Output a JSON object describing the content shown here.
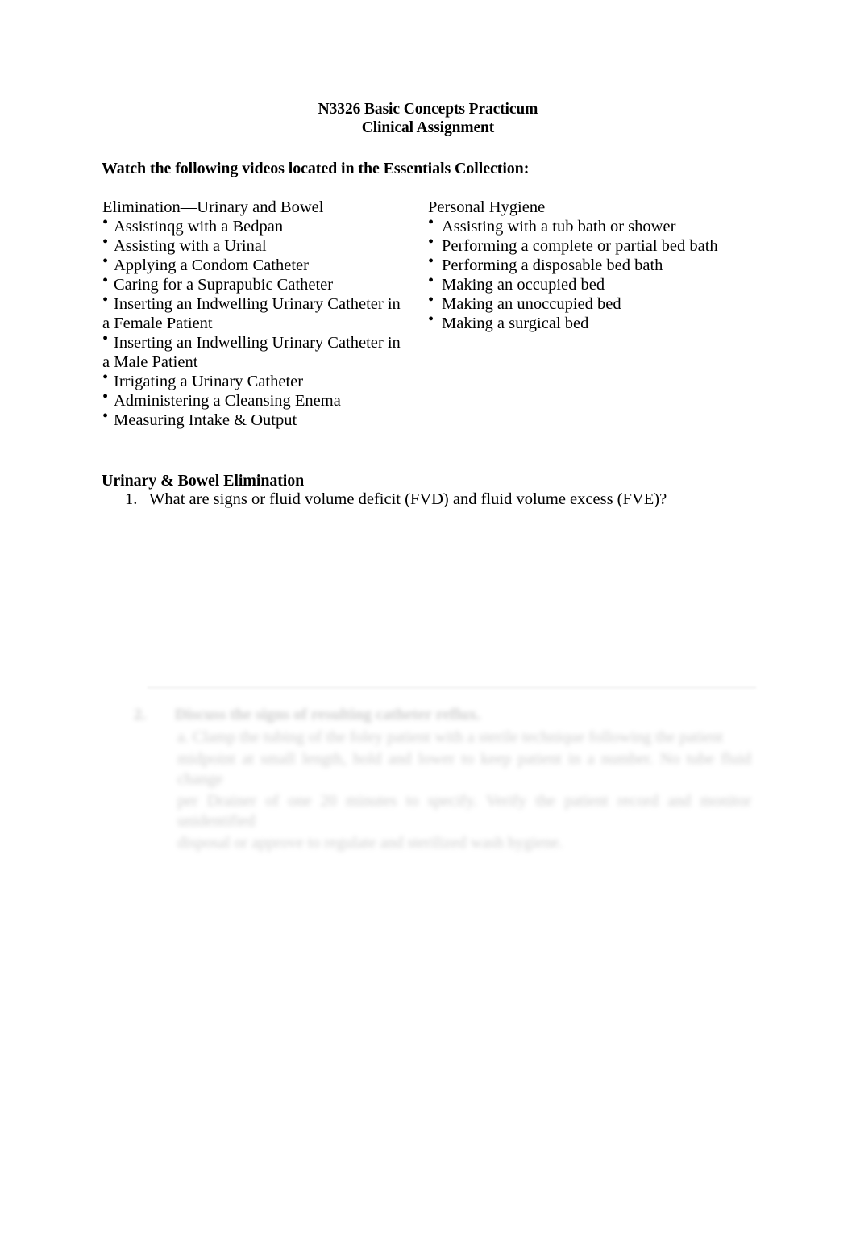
{
  "document": {
    "title_line1": "N3326 Basic Concepts Practicum",
    "title_line2": "Clinical Assignment",
    "watch_heading": "Watch the following videos located in the Essentials Collection:"
  },
  "columns": {
    "left": {
      "heading": "Elimination—Urinary and Bowel",
      "bullet_glyph": "•",
      "items": [
        "Assistinqg with a Bedpan",
        "Assisting with a Urinal",
        "Applying a Condom Catheter",
        "Caring for a Suprapubic Catheter",
        "Inserting an Indwelling Urinary Catheter in a Female Patient",
        "Inserting an Indwelling Urinary Catheter in a Male Patient",
        "Irrigating a Urinary Catheter",
        "Administering a Cleansing Enema",
        "Measuring Intake & Output"
      ]
    },
    "right": {
      "heading": "Personal Hygiene",
      "bullet_glyph": "•",
      "items": [
        "Assisting with a tub bath or shower",
        "Performing a complete or partial bed bath",
        "Performing a disposable bed bath",
        "Making an occupied bed",
        "Making an unoccupied bed",
        "Making a surgical bed"
      ]
    }
  },
  "section": {
    "heading": "Urinary & Bowel Elimination",
    "questions": [
      {
        "number": "1.",
        "text": "What are signs or fluid volume deficit (FVD) and fluid volume excess (FVE)?"
      }
    ]
  },
  "obscured": {
    "note": "illegible faded text block",
    "number": "2.",
    "heading_line": "Discuss the signs of resulting catheter reflux.",
    "body_lines": [
      "a. Clamp the tubing of the foley patient with a sterile technique following the patient",
      "midpoint at small length, hold and lower to keep patient in a number. No tube fluid change",
      "per Drainer of one 20 minutes to specify. Verify the patient record and monitor unidentified",
      "disposal or approve to regulate and sterilized wash hygiene."
    ]
  }
}
